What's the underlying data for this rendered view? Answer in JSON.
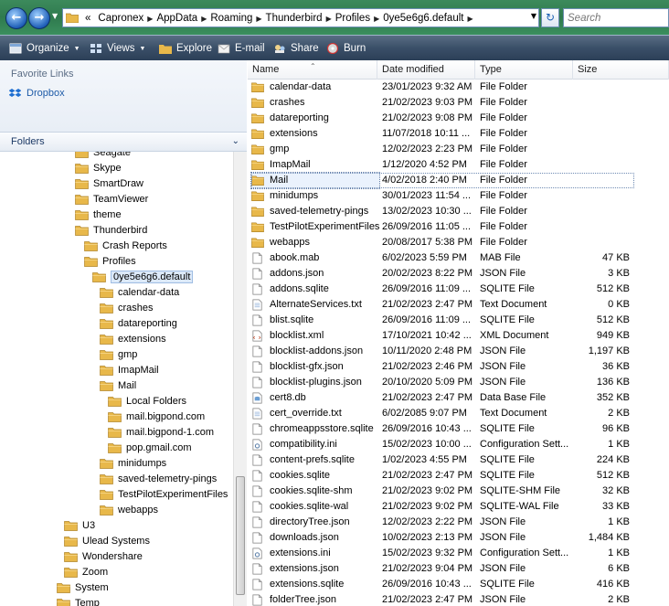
{
  "address_bar": {
    "overflow": "«",
    "crumbs": [
      "Capronex",
      "AppData",
      "Roaming",
      "Thunderbird",
      "Profiles",
      "0ye5e6g6.default"
    ],
    "search_placeholder": "Search"
  },
  "toolbar": {
    "organize": "Organize",
    "views": "Views",
    "explore": "Explore",
    "email": "E-mail",
    "share": "Share",
    "burn": "Burn"
  },
  "left_pane": {
    "favorite_links_heading": "Favorite Links",
    "favorites": [
      "Dropbox"
    ],
    "folders_heading": "Folders",
    "tree": [
      {
        "label": "Seagate",
        "level": 0
      },
      {
        "label": "Skype",
        "level": 0
      },
      {
        "label": "SmartDraw",
        "level": 0
      },
      {
        "label": "TeamViewer",
        "level": 0
      },
      {
        "label": "theme",
        "level": 0
      },
      {
        "label": "Thunderbird",
        "level": 0
      },
      {
        "label": "Crash Reports",
        "level": 1
      },
      {
        "label": "Profiles",
        "level": 1
      },
      {
        "label": "0ye5e6g6.default",
        "level": 2,
        "selected": true
      },
      {
        "label": "calendar-data",
        "level": 3
      },
      {
        "label": "crashes",
        "level": 3
      },
      {
        "label": "datareporting",
        "level": 3
      },
      {
        "label": "extensions",
        "level": 3
      },
      {
        "label": "gmp",
        "level": 3
      },
      {
        "label": "ImapMail",
        "level": 3
      },
      {
        "label": "Mail",
        "level": 3
      },
      {
        "label": "Local Folders",
        "level": 4
      },
      {
        "label": "mail.bigpond.com",
        "level": 4
      },
      {
        "label": "mail.bigpond-1.com",
        "level": 4
      },
      {
        "label": "pop.gmail.com",
        "level": 4
      },
      {
        "label": "minidumps",
        "level": 3
      },
      {
        "label": "saved-telemetry-pings",
        "level": 3
      },
      {
        "label": "TestPilotExperimentFiles",
        "level": 3
      },
      {
        "label": "webapps",
        "level": 3
      },
      {
        "label": "U3",
        "level": -1
      },
      {
        "label": "Ulead Systems",
        "level": -1
      },
      {
        "label": "Wondershare",
        "level": -1
      },
      {
        "label": "Zoom",
        "level": -1
      },
      {
        "label": "System",
        "level": -2
      },
      {
        "label": "Temp",
        "level": -2
      }
    ]
  },
  "columns": {
    "name": "Name",
    "date": "Date modified",
    "type": "Type",
    "size": "Size"
  },
  "files": [
    {
      "name": "calendar-data",
      "date": "23/01/2023 9:32 AM",
      "type": "File Folder",
      "size": "",
      "icon": "folder-icon"
    },
    {
      "name": "crashes",
      "date": "21/02/2023 9:03 PM",
      "type": "File Folder",
      "size": "",
      "icon": "folder-icon"
    },
    {
      "name": "datareporting",
      "date": "21/02/2023 9:08 PM",
      "type": "File Folder",
      "size": "",
      "icon": "folder-icon"
    },
    {
      "name": "extensions",
      "date": "11/07/2018 10:11 ...",
      "type": "File Folder",
      "size": "",
      "icon": "folder-icon"
    },
    {
      "name": "gmp",
      "date": "12/02/2023 2:23 PM",
      "type": "File Folder",
      "size": "",
      "icon": "folder-icon"
    },
    {
      "name": "ImapMail",
      "date": "1/12/2020 4:52 PM",
      "type": "File Folder",
      "size": "",
      "icon": "folder-icon"
    },
    {
      "name": "Mail",
      "date": "4/02/2018 2:40 PM",
      "type": "File Folder",
      "size": "",
      "icon": "folder-icon",
      "selected": true
    },
    {
      "name": "minidumps",
      "date": "30/01/2023 11:54 ...",
      "type": "File Folder",
      "size": "",
      "icon": "folder-icon"
    },
    {
      "name": "saved-telemetry-pings",
      "date": "13/02/2023 10:30 ...",
      "type": "File Folder",
      "size": "",
      "icon": "folder-icon"
    },
    {
      "name": "TestPilotExperimentFiles",
      "date": "26/09/2016 11:05 ...",
      "type": "File Folder",
      "size": "",
      "icon": "folder-icon"
    },
    {
      "name": "webapps",
      "date": "20/08/2017 5:38 PM",
      "type": "File Folder",
      "size": "",
      "icon": "folder-icon"
    },
    {
      "name": "abook.mab",
      "date": "6/02/2023 5:59 PM",
      "type": "MAB File",
      "size": "47 KB",
      "icon": "file-icon"
    },
    {
      "name": "addons.json",
      "date": "20/02/2023 8:22 PM",
      "type": "JSON File",
      "size": "3 KB",
      "icon": "file-icon"
    },
    {
      "name": "addons.sqlite",
      "date": "26/09/2016 11:09 ...",
      "type": "SQLITE File",
      "size": "512 KB",
      "icon": "file-icon"
    },
    {
      "name": "AlternateServices.txt",
      "date": "21/02/2023 2:47 PM",
      "type": "Text Document",
      "size": "0 KB",
      "icon": "text-file-icon"
    },
    {
      "name": "blist.sqlite",
      "date": "26/09/2016 11:09 ...",
      "type": "SQLITE File",
      "size": "512 KB",
      "icon": "file-icon"
    },
    {
      "name": "blocklist.xml",
      "date": "17/10/2021 10:42 ...",
      "type": "XML Document",
      "size": "949 KB",
      "icon": "xml-file-icon"
    },
    {
      "name": "blocklist-addons.json",
      "date": "10/11/2020 2:48 PM",
      "type": "JSON File",
      "size": "1,197 KB",
      "icon": "file-icon"
    },
    {
      "name": "blocklist-gfx.json",
      "date": "21/02/2023 2:46 PM",
      "type": "JSON File",
      "size": "36 KB",
      "icon": "file-icon"
    },
    {
      "name": "blocklist-plugins.json",
      "date": "20/10/2020 5:09 PM",
      "type": "JSON File",
      "size": "136 KB",
      "icon": "file-icon"
    },
    {
      "name": "cert8.db",
      "date": "21/02/2023 2:47 PM",
      "type": "Data Base File",
      "size": "352 KB",
      "icon": "db-file-icon"
    },
    {
      "name": "cert_override.txt",
      "date": "6/02/2085 9:07 PM",
      "type": "Text Document",
      "size": "2 KB",
      "icon": "text-file-icon"
    },
    {
      "name": "chromeappsstore.sqlite",
      "date": "26/09/2016 10:43 ...",
      "type": "SQLITE File",
      "size": "96 KB",
      "icon": "file-icon"
    },
    {
      "name": "compatibility.ini",
      "date": "15/02/2023 10:00 ...",
      "type": "Configuration Sett...",
      "size": "1 KB",
      "icon": "config-file-icon"
    },
    {
      "name": "content-prefs.sqlite",
      "date": "1/02/2023 4:55 PM",
      "type": "SQLITE File",
      "size": "224 KB",
      "icon": "file-icon"
    },
    {
      "name": "cookies.sqlite",
      "date": "21/02/2023 2:47 PM",
      "type": "SQLITE File",
      "size": "512 KB",
      "icon": "file-icon"
    },
    {
      "name": "cookies.sqlite-shm",
      "date": "21/02/2023 9:02 PM",
      "type": "SQLITE-SHM File",
      "size": "32 KB",
      "icon": "file-icon"
    },
    {
      "name": "cookies.sqlite-wal",
      "date": "21/02/2023 9:02 PM",
      "type": "SQLITE-WAL File",
      "size": "33 KB",
      "icon": "file-icon"
    },
    {
      "name": "directoryTree.json",
      "date": "12/02/2023 2:22 PM",
      "type": "JSON File",
      "size": "1 KB",
      "icon": "file-icon"
    },
    {
      "name": "downloads.json",
      "date": "10/02/2023 2:13 PM",
      "type": "JSON File",
      "size": "1,484 KB",
      "icon": "file-icon"
    },
    {
      "name": "extensions.ini",
      "date": "15/02/2023 9:32 PM",
      "type": "Configuration Sett...",
      "size": "1 KB",
      "icon": "config-file-icon"
    },
    {
      "name": "extensions.json",
      "date": "21/02/2023 9:04 PM",
      "type": "JSON File",
      "size": "6 KB",
      "icon": "file-icon"
    },
    {
      "name": "extensions.sqlite",
      "date": "26/09/2016 10:43 ...",
      "type": "SQLITE File",
      "size": "416 KB",
      "icon": "file-icon"
    },
    {
      "name": "folderTree.json",
      "date": "21/02/2023 2:47 PM",
      "type": "JSON File",
      "size": "2 KB",
      "icon": "file-icon"
    }
  ],
  "colors": {
    "folder": "#e8b84a",
    "selection": "#dce9f9",
    "toolbar": "#3a4f68",
    "address_bar": "#2f7a4e"
  }
}
